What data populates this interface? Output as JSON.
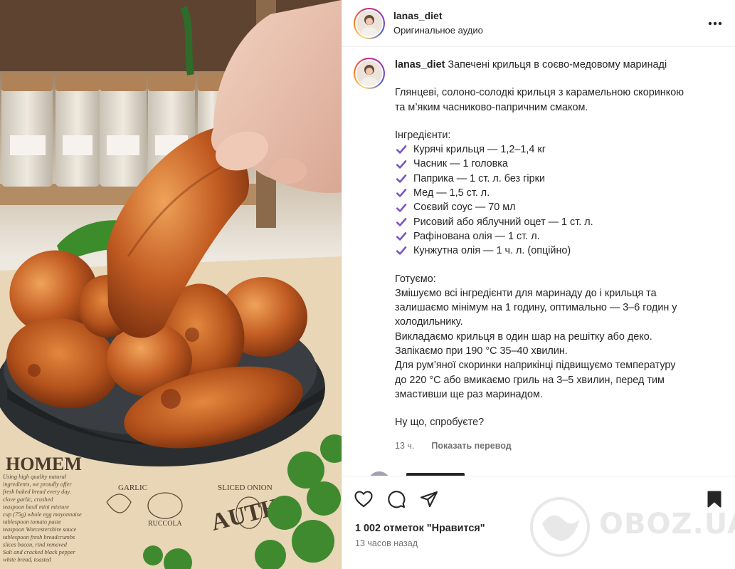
{
  "post": {
    "username": "lanas_diet",
    "audio": "Оригинальное аудио",
    "more_icon": "more-horizontal-icon"
  },
  "caption": {
    "username": "lanas_diet",
    "title": "Запечені крильця в соєво-медовому маринаді",
    "intro": [
      "Глянцеві, солоно-солодкі крильця з карамельною скоринкою",
      "та м’яким часниково-папричним смаком."
    ],
    "ingredients_heading": "Інгредієнти:",
    "ingredients": [
      "Курячі крильця — 1,2–1,4 кг",
      "Часник — 1 головка",
      "Паприка — 1 ст. л. без гірки",
      "Мед — 1,5 ст. л.",
      "Соєвий соус — 70 мл",
      "Рисовий або яблучний оцет — 1 ст. л.",
      "Рафінована олія — 1 ст. л.",
      "Кунжутна олія — 1 ч. л. (опційно)"
    ],
    "check_color": "#7b55c7",
    "steps_heading": "Готуємо:",
    "steps": [
      "Змішуємо всі інгредієнти для маринаду до і крильця та",
      "залишаємо мінімум на 1 годину, оптимально — 3–6 годин у",
      "холодильнику.",
      "Викладаємо крильця в один шар на решітку або деко.",
      "Запікаємо при 190 °С 35–40 хвилин.",
      "Для рум’яної скоринки наприкінці підвищуємо температуру",
      "до 220 °С або вмикаємо гриль на 3–5 хвилин, перед тим",
      "змастивши ще раз маринадом."
    ],
    "closing": "Ну що, спробуєте?",
    "age": "13 ч.",
    "translate": "Показать перевод"
  },
  "actions": {
    "like_icon": "heart-icon",
    "comment_icon": "comment-icon",
    "share_icon": "share-icon",
    "save_icon": "bookmark-icon"
  },
  "likes_text": "1 002 отметок \"Нравится\"",
  "posted_ago": "13 часов назад",
  "watermark": "OBOZ.UA",
  "media_labels": {
    "homemade": "HOMEM",
    "garlic": "GARLIC",
    "sliced_onion": "SLICED ONION",
    "ruccola": "RUCCOLA",
    "auth": "AUTH",
    "recipe_lines": [
      "Using high quality natural",
      "ingredients, we proudly offer",
      "fresh baked bread every day.",
      "clove garlic, crushed",
      "teaspoon basil mini mixture",
      "cup (75g) whole egg mayonnaise",
      "tablespoon tomato paste",
      "teaspoon Worcestershire sauce",
      "tablespoon fresh breadcrumbs",
      "slices bacon, rind removed",
      "Salt and cracked black pepper",
      "white bread, toasted"
    ]
  }
}
